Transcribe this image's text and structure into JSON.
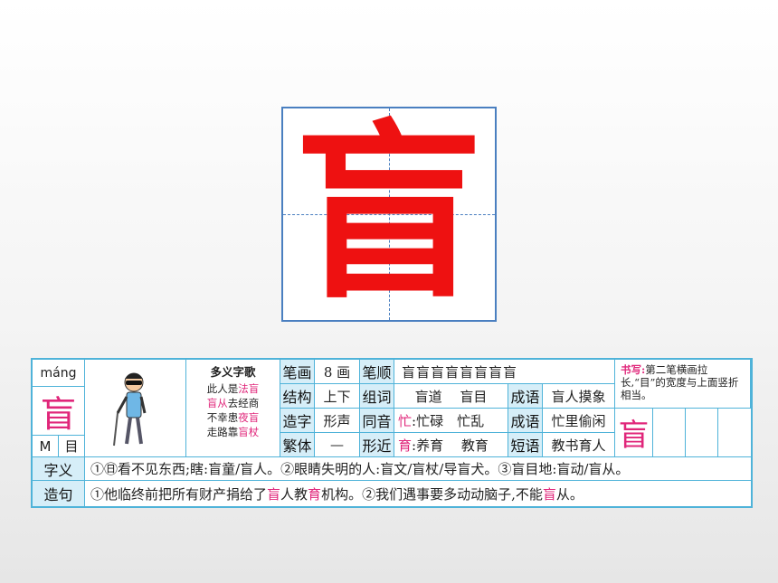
{
  "character": "盲",
  "pinyin": "máng",
  "radical_letter": "M",
  "radical": "目",
  "poem": {
    "title": "多义字歌",
    "lines": [
      [
        "此人是",
        "法盲",
        ""
      ],
      [
        "",
        "盲从",
        "去经商"
      ],
      [
        "不幸患",
        "夜盲",
        ""
      ],
      [
        "走路靠",
        "盲杖",
        ""
      ]
    ]
  },
  "labels": {
    "strokes": "笔画",
    "stroke_order": "笔顺",
    "structure": "结构",
    "words": "组词",
    "idiom": "成语",
    "formation": "造字",
    "homophone": "同音",
    "traditional": "繁体",
    "similar": "形近",
    "phrase": "短语",
    "meaning": "字义",
    "sentence": "造句"
  },
  "values": {
    "strokes": "8 画",
    "stroke_order": "盲盲盲盲盲盲盲盲",
    "structure": "上下",
    "words": "盲道　 盲目",
    "idiom": "盲人摸象",
    "formation": "形声",
    "homophone_char": "忙",
    "homophone_rest": ":忙碌　忙乱",
    "idiom2": "忙里偷闲",
    "traditional": "—",
    "similar_char": "育",
    "similar_rest": ":养育　 教育",
    "phrase": "教书育人"
  },
  "writing_tip": {
    "label": "书写:",
    "text": "第二笔横画拉长,“目”的宽度与上面竖折相当。",
    "practice_char": "盲"
  },
  "meaning": "①㊐看不见东西;瞎:盲童/盲人。②眼睛失明的人:盲文/盲杖/导盲犬。③盲目地:盲动/盲从。",
  "sentence": {
    "p1": "①他临终前把所有财产捐给了",
    "h1": "盲",
    "p2": "人教",
    "h2": "育",
    "p3": "机构。②我们遇事要多动动脑子,不能",
    "h3": "盲",
    "p4": "从。"
  },
  "colors": {
    "accent": "#ee1111",
    "border": "#4fb3d9",
    "label_bg": "#d6eef8",
    "pink": "#e0267a"
  }
}
